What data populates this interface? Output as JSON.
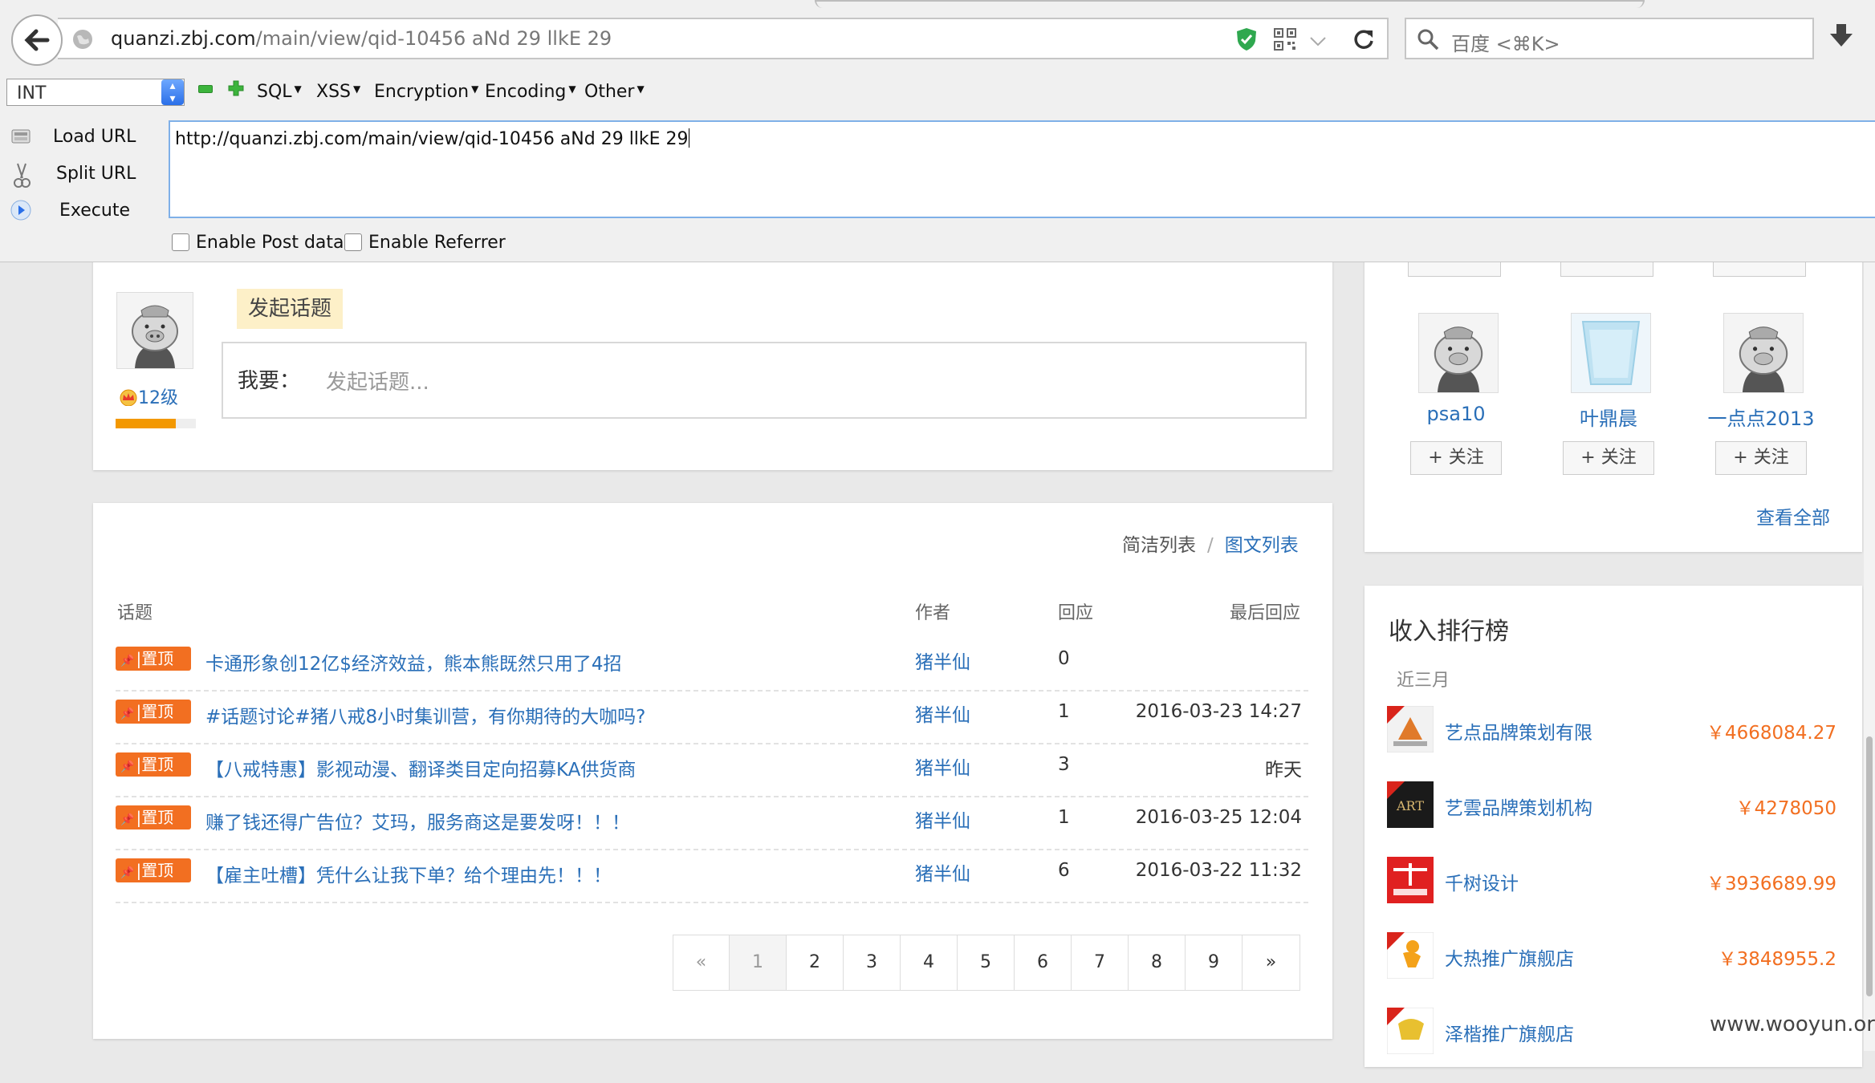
{
  "browser": {
    "url_host": "quanzi.zbj.com",
    "url_path": "/main/view/qid-10456 aNd 29 llkE 29",
    "search_placeholder": "百度 <⌘K>"
  },
  "hackbar": {
    "select_value": "INT",
    "menus": [
      "SQL",
      "XSS",
      "Encryption",
      "Encoding",
      "Other"
    ],
    "load_url": "Load URL",
    "split_url": "Split URL",
    "execute": "Execute",
    "url_value": "http://quanzi.zbj.com/main/view/qid-10456 aNd 29 llkE 29",
    "enable_post": "Enable Post data",
    "enable_referrer": "Enable Referrer"
  },
  "post": {
    "level": "12级",
    "level_progress": 0.75,
    "start_topic": "发起话题",
    "i_want": "我要：",
    "placeholder": "发起话题..."
  },
  "topic_list": {
    "view_simple": "简洁列表",
    "view_sep": "/",
    "view_image": "图文列表",
    "headers": {
      "topic": "话题",
      "author": "作者",
      "replies": "回应",
      "last": "最后回应"
    },
    "badge": "置顶",
    "rows": [
      {
        "title": "卡通形象创12亿$经济效益，熊本熊既然只用了4招",
        "author": "猪半仙",
        "replies": "0",
        "last": ""
      },
      {
        "title": "#话题讨论#猪八戒8小时集训营，有你期待的大咖吗?",
        "author": "猪半仙",
        "replies": "1",
        "last": "2016-03-23 14:27"
      },
      {
        "title": "【八戒特惠】影视动漫、翻译类目定向招募KA供货商",
        "author": "猪半仙",
        "replies": "3",
        "last": "昨天"
      },
      {
        "title": "赚了钱还得广告位？艾玛，服务商这是要发呀！！！",
        "author": "猪半仙",
        "replies": "1",
        "last": "2016-03-25 12:04"
      },
      {
        "title": "【雇主吐槽】凭什么让我下单？给个理由先！！！",
        "author": "猪半仙",
        "replies": "6",
        "last": "2016-03-22 11:32"
      }
    ]
  },
  "pager": [
    "«",
    "1",
    "2",
    "3",
    "4",
    "5",
    "6",
    "7",
    "8",
    "9",
    "»"
  ],
  "follow": {
    "old_follow": "+ 关注",
    "users": [
      {
        "name": "psa10",
        "follow": "+ 关注"
      },
      {
        "name": "叶鼎晨",
        "follow": "+ 关注"
      },
      {
        "name": "一点点2013",
        "follow": "+ 关注"
      }
    ],
    "view_all": "查看全部"
  },
  "income": {
    "title": "收入排行榜",
    "period": "近三月",
    "items": [
      {
        "name": "艺点品牌策划有限",
        "amount": "￥4668084.27",
        "logo_color": "#d9241b"
      },
      {
        "name": "艺雲品牌策划机构",
        "amount": "￥4278050",
        "logo_color": "#1a1a1a"
      },
      {
        "name": "千树设计",
        "amount": "￥3936689.99",
        "logo_color": "#e02020"
      },
      {
        "name": "大热推广旗舰店",
        "amount": "￥3848955.2",
        "logo_color": "#f4a21a"
      },
      {
        "name": "泽楷推广旗舰店",
        "amount": "",
        "logo_color": "#e8c030"
      }
    ]
  },
  "watermark": "www.wooyun.org",
  "colors": {
    "link": "#2a6fb8",
    "accent": "#f26f21",
    "level_bar": "#f39800"
  }
}
